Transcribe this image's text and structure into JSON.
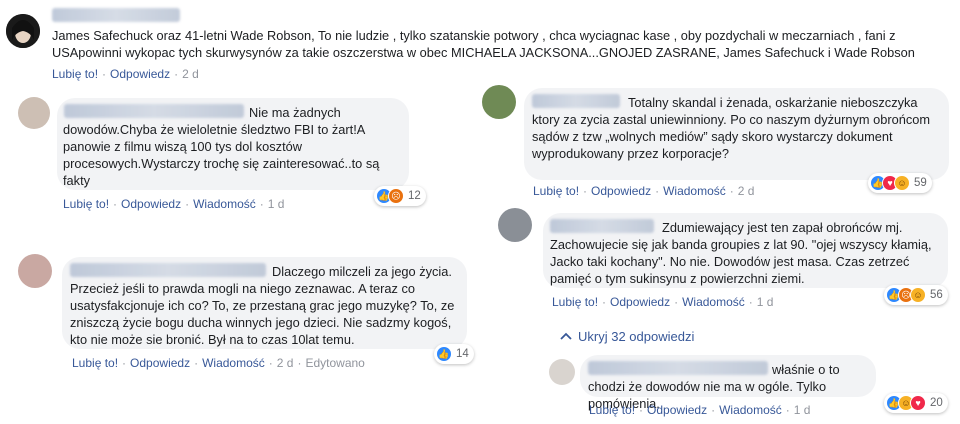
{
  "post": {
    "text": "James Safechuck oraz 41-letni Wade Robson, To nie ludzie , tylko szatanskie potwory , chca wyciagnac kase , oby pozdychali w meczarniach , fani z USApowinni wykopac tych skurwysynów za takie oszczerstwa w obec MICHAELA JACKSONA...GNOJED ZASRANE, James Safechuck i Wade Robson",
    "like": "Lubię to!",
    "reply": "Odpowiedz",
    "time": "2 d"
  },
  "comments": [
    {
      "text": "Nie ma żadnych dowodów.Chyba że wieloletnie śledztwo FBI to żart!A panowie z filmu wiszą 100 tys dol kosztów procesowych.Wystarczy trochę się zainteresować..to są fakty",
      "like": "Lubię to!",
      "reply": "Odpowiedz",
      "message": "Wiadomość",
      "time": "1 d",
      "reaction_count": "12"
    },
    {
      "text": "Dlaczego milczeli za jego życia. Przecież jeśli to prawda mogli na niego zeznawac. A teraz co usatysfakcjonuje ich co? To, ze przestaną grac jego muzykę? To, ze zniszczą życie bogu ducha winnych jego dzieci. Nie sadzmy kogoś, kto nie może sie bronić. Był na to czas 10lat temu.",
      "like": "Lubię to!",
      "reply": "Odpowiedz",
      "message": "Wiadomość",
      "time": "2 d",
      "edited": "Edytowano",
      "reaction_count": "14"
    },
    {
      "text": "Totalny skandal i żenada, oskarżanie nieboszczyka ktory za zycia zastal uniewinniony. Po co naszym dyżurnym obrońcom sądów z tzw „wolnych mediów” sądy skoro wystarczy dokument wyprodukowany przez korporacje?",
      "like": "Lubię to!",
      "reply": "Odpowiedz",
      "message": "Wiadomość",
      "time": "2 d",
      "reaction_count": "59"
    },
    {
      "text": "Zdumiewający jest ten zapał obrońców mj. Zachowujecie się jak banda groupies z lat 90. \"ojej wszyscy kłamią, Jacko taki kochany\". No nie. Dowodów jest masa. Czas zetrzeć pamięć o tym sukinsynu z powierzchni ziemi.",
      "like": "Lubię to!",
      "reply": "Odpowiedz",
      "message": "Wiadomość",
      "time": "1 d",
      "reaction_count": "56"
    }
  ],
  "hide_replies": "Ukryj 32 odpowiedzi",
  "reply": {
    "text": "właśnie o to chodzi że dowodów nie ma w ogóle. Tylko pomówienia.",
    "like": "Lubię to!",
    "reply": "Odpowiedz",
    "message": "Wiadomość",
    "time": "1 d",
    "reaction_count": "20"
  },
  "icons": {
    "like": "like-reaction-icon",
    "love": "love-reaction-icon",
    "angry": "angry-reaction-icon",
    "haha": "haha-reaction-icon",
    "chevron": "chevron-up-icon"
  },
  "colors": {
    "link": "#385898",
    "meta": "#90949c",
    "bubble": "#f2f3f5",
    "like": "#2d88ff",
    "love": "#f0284a",
    "angry": "#e9710f",
    "haha": "#f7b125"
  }
}
